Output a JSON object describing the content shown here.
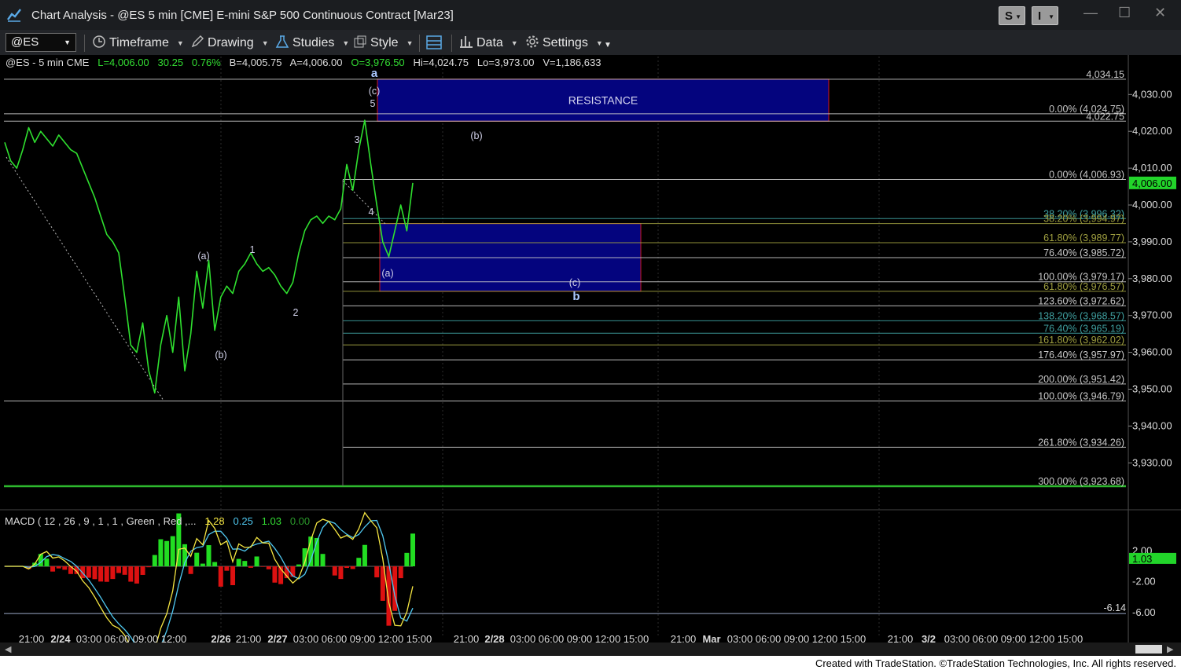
{
  "window": {
    "title": "Chart Analysis - @ES 5 min [CME] E-mini S&P 500 Continuous Contract [Mar23]",
    "btn_s": "S",
    "btn_i": "I",
    "min": "—",
    "max": "☐",
    "close": "✕"
  },
  "toolbar": {
    "symbol": "@ES",
    "timeframe": "Timeframe",
    "drawing": "Drawing",
    "studies": "Studies",
    "style": "Style",
    "data": "Data",
    "settings": "Settings"
  },
  "quote": {
    "sym": "@ES - 5 min  CME",
    "last": "L=4,006.00",
    "chg": "30.25",
    "pct": "0.76%",
    "bid": "B=4,005.75",
    "ask": "A=4,006.00",
    "open": "O=3,976.50",
    "hi": "Hi=4,024.75",
    "lo": "Lo=3,973.00",
    "vol": "V=1,186,633"
  },
  "macd": {
    "label": "MACD ( 12 , 26 , 9 , 1 , 1 , Green , Red ,...",
    "v1": "1.28",
    "v2": "0.25",
    "v3": "1.03",
    "v4": "0.00",
    "current": "1.03",
    "y_ticks": [
      2.0,
      -2.0,
      -6.0
    ],
    "y_labels": [
      "2.00",
      "-2.00",
      "-6.00"
    ],
    "line_value": "-6.14"
  },
  "chart_data": {
    "type": "line",
    "title": "@ES 5 min",
    "ylim": [
      3920,
      4040
    ],
    "y_ticks": [
      4030,
      4020,
      4010,
      4000,
      3990,
      3980,
      3970,
      3960,
      3950,
      3940,
      3930
    ],
    "y_tick_labels": [
      "4,030.00",
      "4,020.00",
      "4,010.00",
      "4,000.00",
      "3,990.00",
      "3,980.00",
      "3,970.00",
      "3,960.00",
      "3,950.00",
      "3,940.00",
      "3,930.00"
    ],
    "current_price": "4,006.00",
    "x_tick_labels": [
      "21:00",
      "2/24",
      "03:00",
      "06:00",
      "09:00",
      "12:00",
      "2/26",
      "21:00",
      "2/27",
      "03:00",
      "06:00",
      "09:00",
      "12:00",
      "15:00",
      "21:00",
      "2/28",
      "03:00",
      "06:00",
      "09:00",
      "12:00",
      "15:00",
      "21:00",
      "Mar",
      "03:00",
      "06:00",
      "09:00",
      "12:00",
      "15:00",
      "21:00",
      "3/2",
      "03:00",
      "06:00",
      "09:00",
      "12:00",
      "15:00"
    ],
    "bold_x_ticks": [
      "2/24",
      "2/26",
      "2/27",
      "2/28",
      "Mar",
      "3/2"
    ],
    "price_series": [
      4017,
      4012,
      4010,
      4015,
      4021,
      4017,
      4020,
      4018,
      4016,
      4019,
      4017,
      4015,
      4014,
      4010,
      4006,
      4002,
      3997,
      3992,
      3990,
      3987,
      3975,
      3962,
      3960,
      3968,
      3955,
      3949,
      3962,
      3970,
      3960,
      3975,
      3955,
      3965,
      3982,
      3972,
      3985,
      3966,
      3975,
      3978,
      3976,
      3982,
      3984,
      3987,
      3984,
      3982,
      3983,
      3981,
      3978,
      3976,
      3979,
      3987,
      3993,
      3996,
      3997,
      3995,
      3997,
      3996,
      3999,
      4011,
      4004,
      4015,
      4023,
      4011,
      4000,
      3990,
      3986,
      3993,
      4000,
      3993,
      4006
    ],
    "levels": [
      {
        "label": "4,034.15",
        "price": 4034.15,
        "color": "#c8c8c8"
      },
      {
        "label": "0.00% (4,024.75)",
        "price": 4024.75,
        "color": "#c8c8c8"
      },
      {
        "label": "4,022.75",
        "price": 4022.75,
        "color": "#c8c8c8"
      },
      {
        "label": "0.00% (4,006.93)",
        "price": 4006.93,
        "color": "#c8c8c8"
      },
      {
        "label": "38.20% (3,996.32)",
        "price": 3996.32,
        "color": "#3fa0a0"
      },
      {
        "label": "38.20% (3,994.97)",
        "price": 3994.97,
        "color": "#a0a040"
      },
      {
        "label": "61.80% (3,989.77)",
        "price": 3989.77,
        "color": "#a0a040"
      },
      {
        "label": "76.40% (3,985.72)",
        "price": 3985.72,
        "color": "#c8c8c8"
      },
      {
        "label": "100.00% (3,979.17)",
        "price": 3979.17,
        "color": "#c8c8c8"
      },
      {
        "label": "61.80% (3,976.57)",
        "price": 3976.57,
        "color": "#a0a040"
      },
      {
        "label": "123.60% (3,972.62)",
        "price": 3972.62,
        "color": "#c8c8c8"
      },
      {
        "label": "138.20% (3,968.57)",
        "price": 3968.57,
        "color": "#3fa0a0"
      },
      {
        "label": "76.40% (3,965.19)",
        "price": 3965.19,
        "color": "#3fa0a0"
      },
      {
        "label": "161.80% (3,962.02)",
        "price": 3962.02,
        "color": "#a0a040"
      },
      {
        "label": "176.40% (3,957.97)",
        "price": 3957.97,
        "color": "#c8c8c8"
      },
      {
        "label": "200.00% (3,951.42)",
        "price": 3951.42,
        "color": "#c8c8c8"
      },
      {
        "label": "100.00% (3,946.79)",
        "price": 3946.79,
        "color": "#c8c8c8"
      },
      {
        "label": "261.80% (3,934.26)",
        "price": 3934.26,
        "color": "#c8c8c8"
      },
      {
        "label": "300.00% (3,923.68)",
        "price": 3923.68,
        "color": "#c8c8c8"
      }
    ],
    "zones": [
      {
        "label": "RESISTANCE",
        "top": 4034.15,
        "bottom": 4022.75
      },
      {
        "label": "",
        "top": 3994.97,
        "bottom": 3976.57
      }
    ],
    "wave_labels": [
      "a",
      "(c)",
      "5",
      "3",
      "4",
      "(b)",
      "(a)",
      "1",
      "2",
      "(b)",
      "(a)",
      "(c)",
      "b"
    ]
  },
  "footer": "Created with TradeStation. ©TradeStation Technologies, Inc. All rights reserved.",
  "colors": {
    "zone_fill": "#04047e",
    "zone_border": "#d01818",
    "green_line": "#33cc33",
    "price_line": "#2fe02f",
    "current_tag": "#22d42a"
  }
}
